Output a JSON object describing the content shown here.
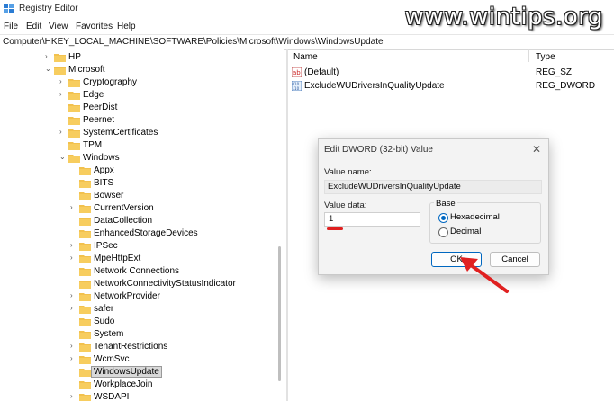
{
  "window": {
    "title": "Registry Editor"
  },
  "watermark": "www.wintips.org",
  "menu": [
    "File",
    "Edit",
    "View",
    "Favorites",
    "Help"
  ],
  "address": "Computer\\HKEY_LOCAL_MACHINE\\SOFTWARE\\Policies\\Microsoft\\Windows\\WindowsUpdate",
  "tree": [
    {
      "label": "HP",
      "expanded": false
    },
    {
      "label": "Microsoft",
      "expanded": true
    },
    {
      "label": "Cryptography",
      "expanded": false
    },
    {
      "label": "Edge",
      "expanded": false
    },
    {
      "label": "PeerDist",
      "expanded": null
    },
    {
      "label": "Peernet",
      "expanded": null
    },
    {
      "label": "SystemCertificates",
      "expanded": false
    },
    {
      "label": "TPM",
      "expanded": null
    },
    {
      "label": "Windows",
      "expanded": true
    },
    {
      "label": "Appx",
      "expanded": null
    },
    {
      "label": "BITS",
      "expanded": null
    },
    {
      "label": "Bowser",
      "expanded": null
    },
    {
      "label": "CurrentVersion",
      "expanded": false
    },
    {
      "label": "DataCollection",
      "expanded": null
    },
    {
      "label": "EnhancedStorageDevices",
      "expanded": null
    },
    {
      "label": "IPSec",
      "expanded": false
    },
    {
      "label": "MpeHttpExt",
      "expanded": false
    },
    {
      "label": "Network Connections",
      "expanded": null
    },
    {
      "label": "NetworkConnectivityStatusIndicator",
      "expanded": null
    },
    {
      "label": "NetworkProvider",
      "expanded": false
    },
    {
      "label": "safer",
      "expanded": false
    },
    {
      "label": "Sudo",
      "expanded": null
    },
    {
      "label": "System",
      "expanded": null
    },
    {
      "label": "TenantRestrictions",
      "expanded": false
    },
    {
      "label": "WcmSvc",
      "expanded": false
    },
    {
      "label": "WindowsUpdate",
      "expanded": null,
      "selected": true
    },
    {
      "label": "WorkplaceJoin",
      "expanded": null
    },
    {
      "label": "WSDAPI",
      "expanded": false
    }
  ],
  "values": {
    "col_name": "Name",
    "col_type": "Type",
    "rows": [
      {
        "name": "(Default)",
        "type": "REG_SZ",
        "icon": "string-value-icon"
      },
      {
        "name": "ExcludeWUDriversInQualityUpdate",
        "type": "REG_DWORD",
        "icon": "dword-value-icon"
      }
    ]
  },
  "dialog": {
    "title": "Edit DWORD (32-bit) Value",
    "value_name_label": "Value name:",
    "value_name": "ExcludeWUDriversInQualityUpdate",
    "value_data_label": "Value data:",
    "value_data": "1",
    "base_label": "Base",
    "hex_label": "Hexadecimal",
    "dec_label": "Decimal",
    "base_selected": "Hexadecimal",
    "ok_label": "OK",
    "cancel_label": "Cancel",
    "close_glyph": "✕"
  },
  "colors": {
    "accent": "#0067c0",
    "folder": "#f2c14e",
    "annotation": "#e02020"
  }
}
